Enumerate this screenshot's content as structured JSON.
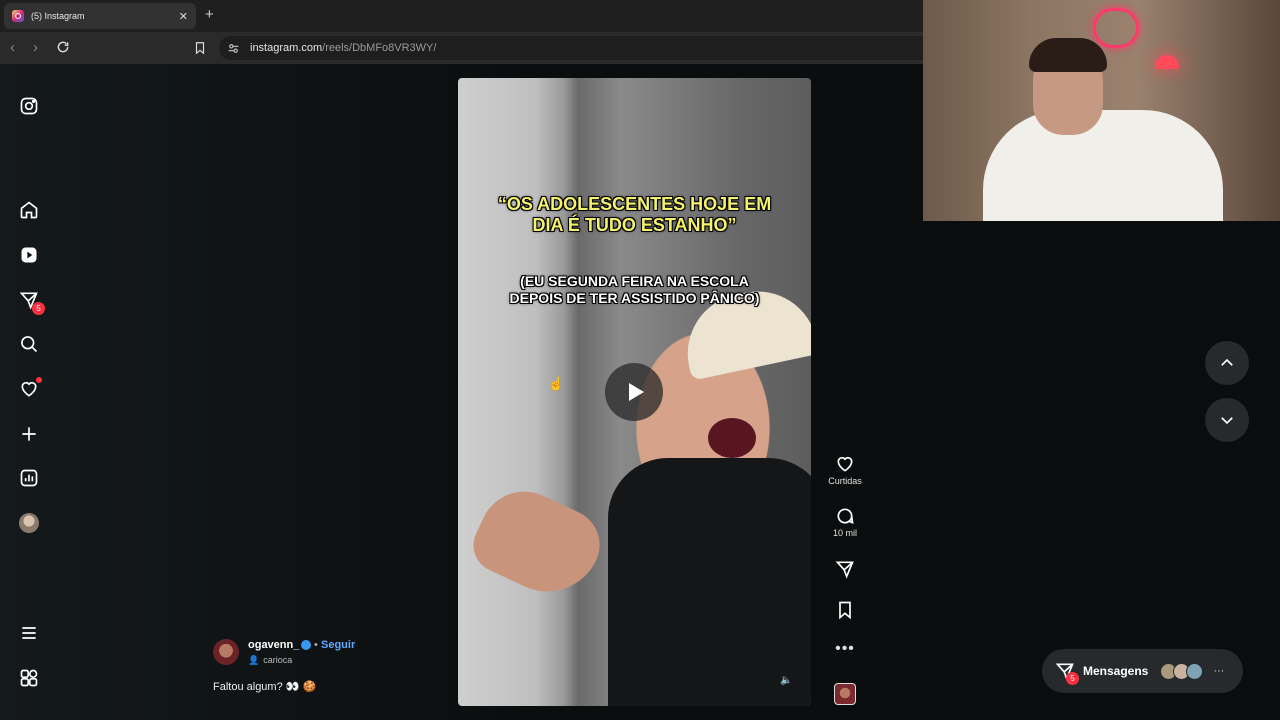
{
  "browser": {
    "tab_title": "(5) Instagram",
    "url_host": "instagram.com",
    "url_path": "/reels/DbMFo8VR3WY/"
  },
  "sidebar": {
    "notification_badge": "5",
    "items": [
      "instagram-logo",
      "home",
      "reels",
      "direct",
      "search",
      "notifications",
      "create",
      "dashboard",
      "profile",
      "more",
      "also-from-meta"
    ]
  },
  "reel": {
    "caption_main": "“OS ADOLESCENTES HOJE EM\nDIA É TUDO ESTANHO”",
    "caption_sub": "(EU SEGUNDA FEIRA NA ESCOLA\nDEPOIS DE TER ASSISTIDO PÂNICO)"
  },
  "actions": {
    "likes_label": "Curtidas",
    "comments_count": "10 mil"
  },
  "author": {
    "username": "ogavenn_",
    "follow_separator": "•",
    "follow_label": "Seguir",
    "audio_user": "carioca",
    "caption": "Faltou algum? 👀 🍪"
  },
  "messages": {
    "label": "Mensagens",
    "badge": "5",
    "more": "···"
  },
  "colors": {
    "accent_blue": "#5ea9ff",
    "badge_red": "#ff3040",
    "caption_yellow": "#f4f36a"
  }
}
